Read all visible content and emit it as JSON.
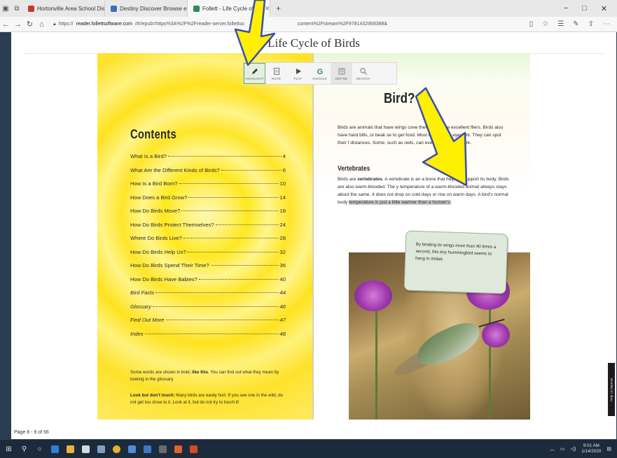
{
  "browser": {
    "tabs": [
      {
        "label": "Hortonville Area School Dis",
        "favicon_color": "#c23a2b"
      },
      {
        "label": "Destiny Discover Browse eB",
        "favicon_color": "#3e6fb4"
      },
      {
        "label": "Follett - Life Cycle of Bir",
        "favicon_color": "#2c8c5a"
      }
    ],
    "window_controls": {
      "minimize": "−",
      "maximize": "□",
      "close": "✕"
    },
    "url": {
      "prefix": "https://",
      "host": "reader.follettsoftware.com",
      "path": "/#!/epub=https%3A%2F%2Freader-server.follettso",
      "tail": "content%2Fstream%2F9781432959388&"
    }
  },
  "reader": {
    "book_title": "Life Cycle of Birds",
    "toolbar": [
      {
        "label": "HIGHLIGHT",
        "icon": "pencil-icon"
      },
      {
        "label": "NOTE",
        "icon": "note-icon"
      },
      {
        "label": "PLAY",
        "icon": "play-icon"
      },
      {
        "label": "GOOGLE",
        "icon": "google-icon"
      },
      {
        "label": "DEFINE",
        "icon": "book-icon"
      },
      {
        "label": "SEARCH",
        "icon": "search-icon"
      }
    ],
    "page_indicator": "Page 8 - 9 of 56",
    "feedback_tab": "Help Us Improve",
    "left_page": {
      "heading": "Contents",
      "toc": [
        {
          "title": "What Is a Bird?",
          "page": "4",
          "italic": false
        },
        {
          "title": "What Are the Different Kinds of Birds?",
          "page": "6",
          "italic": false
        },
        {
          "title": "How Is a Bird Born?",
          "page": "10",
          "italic": false
        },
        {
          "title": "How Does a Bird Grow?",
          "page": "14",
          "italic": false
        },
        {
          "title": "How Do Birds Move?",
          "page": "18",
          "italic": false
        },
        {
          "title": "How Do Birds Protect Themselves?",
          "page": "24",
          "italic": false
        },
        {
          "title": "Where Do Birds Live?",
          "page": "28",
          "italic": false
        },
        {
          "title": "How Do Birds Help Us?",
          "page": "32",
          "italic": false
        },
        {
          "title": "How Do Birds Spend Their Time?",
          "page": "36",
          "italic": false
        },
        {
          "title": "How Do Birds Have Babies?",
          "page": "40",
          "italic": false
        },
        {
          "title": "Bird Facts",
          "page": "44",
          "italic": true
        },
        {
          "title": "Glossary",
          "page": "46",
          "italic": true
        },
        {
          "title": "Find Out More",
          "page": "47",
          "italic": true
        },
        {
          "title": "Index",
          "page": "48",
          "italic": true
        }
      ],
      "bold_note": {
        "before": "Some words are shown in bold, ",
        "bold": "like this",
        "after": ". You can find out what they mean by looking in the glossary."
      },
      "touch_note": {
        "bold": "Look but don’t touch:",
        "after": " Many birds are easily hurt. If you see one in the wild, do not get too close to it. Look at it, but do not try to touch it!"
      }
    },
    "right_page": {
      "heading": "Bird?",
      "intro": "Birds are animals that have wings cove thers. Most are excellent fliers. Birds also have hard bills, or beak se to get food. Most have sharp eyesight. They can spot their f distances. Some, such as owls, can even see it in the dark.",
      "vert_heading": "Vertebrates",
      "vert_text": {
        "before": "Birds are ",
        "bold": "vertebrates",
        "middle": ". A vertebrate is an a bone that helps to support its body. Birds are also warm-blooded. The y temperature of a warm-blooded animal always stays about the same. It does not drop on cold days or rise on warm days. A bird’s normal body ",
        "highlighted": "temperature is just a little warmer than a human’s."
      },
      "caption": "By beating its wings more than 40 times a second, this tiny hummingbird seems to hang in midair.",
      "page_number": "4"
    }
  },
  "taskbar": {
    "clock_time": "9:01 AM",
    "clock_date": "1/14/2020"
  }
}
